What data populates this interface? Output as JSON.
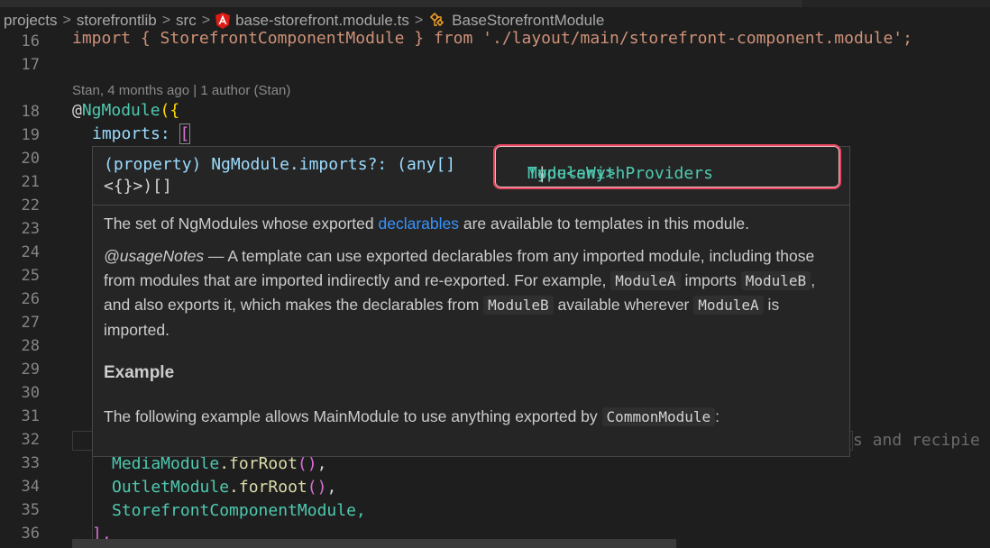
{
  "breadcrumb": {
    "items": [
      "projects",
      "storefrontlib",
      "src",
      "base-storefront.module.ts",
      "BaseStorefrontModule"
    ],
    "separator": ">"
  },
  "blame": "Stan, 4 months ago | 1 author (Stan)",
  "line_numbers": [
    "16",
    "17",
    "18",
    "19",
    "20",
    "21",
    "22",
    "23",
    "24",
    "25",
    "26",
    "27",
    "28",
    "29",
    "30",
    "31",
    "32",
    "33",
    "34",
    "35",
    "36"
  ],
  "code": {
    "line16": "import { StorefrontComponentModule } from './layout/main/storefront-component.module';",
    "line18_at": "@",
    "line18_dec": "NgModule",
    "line18_rest": "({",
    "line19": "imports: ",
    "line19_bracket": "[",
    "line32_tail": "s and recipie",
    "line33_name": "MediaModule",
    "line33_call": ".forRoot",
    "line33_parens": "()",
    "line33_end": ",",
    "line34_name": "OutletModule",
    "line34_call": ".forRoot",
    "line34_parens": "()",
    "line34_end": ",",
    "line35": "StorefrontComponentModule,",
    "line36": "],"
  },
  "hover": {
    "sig_prefix": "(property) NgModule.imports?: (any[]",
    "sig_line2": "<{}>)[]",
    "sig_highlight_a": "Type<any>",
    "sig_highlight_b": " | ",
    "sig_highlight_c": "ModuleWithProviders",
    "doc_p1_a": "The set of NgModules whose exported ",
    "doc_p1_link": "declarables",
    "doc_p1_b": " are available to templates in this module.",
    "usage_tag": "@usageNotes",
    "usage_a": " — A template can use exported declarables from any imported module, including those from modules that are imported indirectly and re-exported. For example, ",
    "code_moduleA": "ModuleA",
    "usage_b": " imports ",
    "code_moduleB": "ModuleB",
    "usage_c": ", and also exports it, which makes the declarables from ",
    "usage_d": " available wherever ",
    "usage_e": " is imported.",
    "example_heading": "Example",
    "example_a": "The following example allows MainModule to use anything exported by ",
    "code_common": "CommonModule",
    "example_b": ":"
  },
  "colors": {
    "background": "#1e1e1e",
    "hover_bg": "#252526",
    "highlight_border": "#e84860",
    "link": "#3794ff",
    "type": "#4ec9b0",
    "property": "#9cdcfe"
  }
}
